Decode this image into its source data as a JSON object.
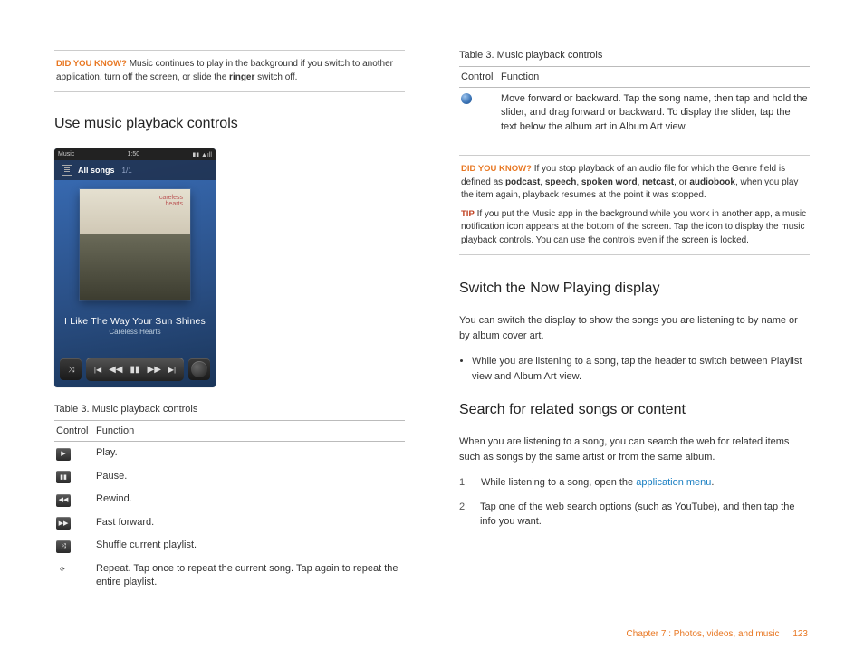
{
  "left": {
    "dyk1": {
      "label": "DID YOU KNOW?",
      "text_a": "Music continues to play in the background if you switch to another application, turn off the screen, or slide the ",
      "bold": "ringer",
      "text_b": " switch off."
    },
    "h_playback": "Use music playback controls",
    "phone": {
      "status_left": "Music",
      "status_time": "1:50",
      "header_label": "All songs",
      "header_count": "1/1",
      "album_brand_a": "careless",
      "album_brand_b": "hearts",
      "song_title": "I Like The Way Your Sun Shines",
      "song_artist": "Careless Hearts"
    },
    "table_title": "Table 3.  Music playback controls",
    "th_control": "Control",
    "th_function": "Function",
    "rows": [
      {
        "f": "Play."
      },
      {
        "f": "Pause."
      },
      {
        "f": "Rewind."
      },
      {
        "f": "Fast forward."
      },
      {
        "f": "Shuffle current playlist."
      },
      {
        "f": "Repeat. Tap once to repeat the current song. Tap again to repeat the entire playlist."
      }
    ]
  },
  "right": {
    "table_title": "Table 3.  Music playback controls",
    "th_control": "Control",
    "th_function": "Function",
    "row_slider": "Move forward or backward. Tap the song name, then tap and hold the slider, and drag forward or backward. To display the slider, tap the text below the album art in Album Art view.",
    "dyk2": {
      "label": "DID YOU KNOW?",
      "pre": "If you stop playback of an audio file for which the Genre field is defined as ",
      "b1": "podcast",
      "b2": "speech",
      "b3": "spoken word",
      "b4": "netcast",
      "b5": "audiobook",
      "tail": ", when you play the item again, playback resumes at the point it was stopped."
    },
    "tip": {
      "label": "TIP",
      "text": "If you put the Music app in the background while you work in another app, a music notification icon appears at the bottom of the screen. Tap the icon to display the music playback controls. You can use the controls even if the screen is locked."
    },
    "h_switch": "Switch the Now Playing display",
    "p_switch": "You can switch the display to show the songs you are listening to by name or by album cover art.",
    "bullet_switch": "While you are listening to a song, tap the header to switch between Playlist view and Album Art view.",
    "h_search": "Search for related songs or content",
    "p_search": "When you are listening to a song, you can search the web for related items such as songs by the same artist or from the same album.",
    "step1_a": "While listening to a song, open the ",
    "step1_link": "application menu",
    "step1_b": ".",
    "step2": "Tap one of the web search options (such as YouTube), and then tap the info you want."
  },
  "footer": {
    "chapter": "Chapter 7  :  Photos, videos, and music",
    "page": "123"
  }
}
